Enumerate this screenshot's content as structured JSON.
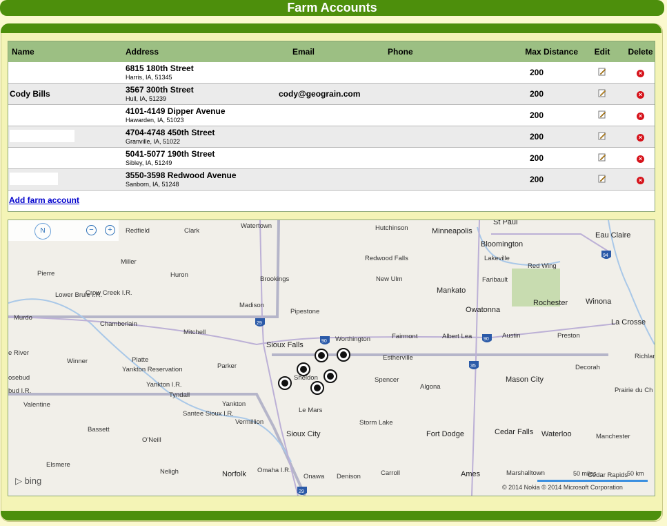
{
  "page": {
    "title": "Farm Accounts"
  },
  "table": {
    "headers": {
      "name": "Name",
      "address": "Address",
      "email": "Email",
      "phone": "Phone",
      "max_distance": "Max Distance",
      "edit": "Edit",
      "delete": "Delete"
    },
    "rows": [
      {
        "name": "",
        "street": "6815 180th Street",
        "city": "Harris, IA, 51345",
        "email": "",
        "phone": "",
        "max_distance": "200"
      },
      {
        "name": "Cody Bills",
        "street": "3567 300th Street",
        "city": "Hull, IA, 51239",
        "email": "cody@geograin.com",
        "phone": "",
        "max_distance": "200"
      },
      {
        "name": "",
        "street": "4101-4149 Dipper Avenue",
        "city": "Hawarden, IA, 51023",
        "email": "",
        "phone": "",
        "max_distance": "200"
      },
      {
        "name": "",
        "street": "4704-4748 450th Street",
        "city": "Granville, IA, 51022",
        "email": "",
        "phone": "",
        "max_distance": "200"
      },
      {
        "name": "",
        "street": "5041-5077 190th Street",
        "city": "Sibley, IA, 51249",
        "email": "",
        "phone": "",
        "max_distance": "200"
      },
      {
        "name": "",
        "street": "3550-3598 Redwood Avenue",
        "city": "Sanborn, IA, 51248",
        "email": "",
        "phone": "",
        "max_distance": "200"
      }
    ],
    "add_link": "Add farm account"
  },
  "map": {
    "compass_label": "N",
    "zoom_out": "−",
    "zoom_in": "+",
    "logo": "bing",
    "copyright": "© 2014 Nokia   © 2014 Microsoft Corporation",
    "scale_miles": "50 miles",
    "scale_km": "50 km",
    "cities": {
      "redfield": "Redfield",
      "clark": "Clark",
      "watertown": "Watertown",
      "hutchinson": "Hutchinson",
      "minneapolis": "Minneapolis",
      "st_paul": "St Paul",
      "bloomington": "Bloomington",
      "eau_claire": "Eau Claire",
      "miller": "Miller",
      "lakeville": "Lakeville",
      "pierre": "Pierre",
      "huron": "Huron",
      "brookings": "Brookings",
      "redwood_falls": "Redwood Falls",
      "faribault": "Faribault",
      "red_wing": "Red Wing",
      "new_ulm": "New Ulm",
      "mankato": "Mankato",
      "crow_creek": "Crow Creek I.R.",
      "lower_brule": "Lower Brule I.R.",
      "madison": "Madison",
      "rochester": "Rochester",
      "winona": "Winona",
      "pipestone": "Pipestone",
      "owatonna": "Owatonna",
      "murdo": "Murdo",
      "chamberlain": "Chamberlain",
      "la_crosse": "La Crosse",
      "mitchell": "Mitchell",
      "sioux_falls": "Sioux Falls",
      "worthington": "Worthington",
      "fairmont": "Fairmont",
      "albert_lea": "Albert Lea",
      "austin": "Austin",
      "preston": "Preston",
      "white_river": "e River",
      "winner": "Winner",
      "platte": "Platte",
      "parker": "Parker",
      "estherville": "Estherville",
      "richland_center": "Richlan Cent",
      "decorah": "Decorah",
      "rosebud": "osebud",
      "yankton_res": "Yankton Reservation",
      "yankton_ir": "Yankton I.R.",
      "sheldon": "Sheldon",
      "spencer": "Spencer",
      "algona": "Algona",
      "mason_city": "Mason City",
      "prairie_du_chien": "Prairie du Ch",
      "rosebud_ir": "bud I.R.",
      "tyndall": "Tyndall",
      "valentine": "Valentine",
      "yankton": "Yankton",
      "le_mars": "Le Mars",
      "santee": "Santee Sioux I.R.",
      "vermillion": "Vermillion",
      "storm_lake": "Storm Lake",
      "bassett": "Bassett",
      "oneill": "O'Neill",
      "sioux_city": "Sioux City",
      "fort_dodge": "Fort Dodge",
      "cedar_falls": "Cedar Falls",
      "waterloo": "Waterloo",
      "manchester": "Manchester",
      "elsmere": "Elsmere",
      "neligh": "Neligh",
      "norfolk": "Norfolk",
      "omaha_ir": "Omaha I.R.",
      "onawa": "Onawa",
      "denison": "Denison",
      "carroll": "Carroll",
      "ames": "Ames",
      "marshalltown": "Marshalltown",
      "cedar_rapids": "Cedar Rapids"
    },
    "highways": [
      "29",
      "90",
      "90",
      "35",
      "94",
      "29"
    ]
  },
  "colors": {
    "header_green": "#4d8f0c",
    "table_header": "#9cbf83",
    "link": "#0000cc",
    "delete": "#d6131b"
  }
}
